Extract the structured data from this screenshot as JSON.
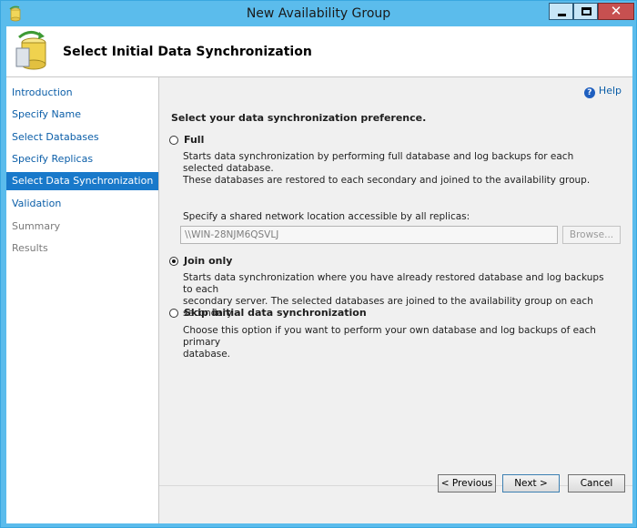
{
  "window": {
    "title": "New Availability Group"
  },
  "header": {
    "title": "Select Initial Data Synchronization"
  },
  "nav": {
    "items": [
      {
        "label": "Introduction",
        "state": "link"
      },
      {
        "label": "Specify Name",
        "state": "link"
      },
      {
        "label": "Select Databases",
        "state": "link"
      },
      {
        "label": "Specify Replicas",
        "state": "link"
      },
      {
        "label": "Select Data Synchronization",
        "state": "selected"
      },
      {
        "label": "Validation",
        "state": "link"
      },
      {
        "label": "Summary",
        "state": "disabled"
      },
      {
        "label": "Results",
        "state": "disabled"
      }
    ]
  },
  "main": {
    "help_label": "Help",
    "preference_label": "Select your data synchronization preference.",
    "options": {
      "full": {
        "label": "Full",
        "selected": false,
        "description_line1": "Starts data synchronization by performing full database and log backups for each selected database.",
        "description_line2": "These databases are restored to each secondary and joined to the availability group."
      },
      "join_only": {
        "label": "Join only",
        "selected": true,
        "description_line1": "Starts data synchronization where you have already restored database and log backups to each",
        "description_line2": "secondary server. The selected databases are joined to the availability group on each secondary."
      },
      "skip": {
        "label": "Skip initial data synchronization",
        "selected": false,
        "description_line1": "Choose this option if you want to perform your own database and log backups of each primary",
        "description_line2": "database."
      }
    },
    "shared_location_label": "Specify a shared network location accessible by all replicas:",
    "shared_location_value": "\\\\WIN-28NJM6QSVLJ",
    "browse_label": "Browse..."
  },
  "buttons": {
    "previous": "< Previous",
    "next": "Next >",
    "cancel": "Cancel"
  },
  "colors": {
    "title_bar": "#5bbcec",
    "nav_selected": "#1979ca",
    "link": "#0b5ea8",
    "close_button": "#c75050"
  },
  "icons": {
    "app": "availability-group-app-icon",
    "header": "database-sync-icon",
    "help": "help-icon"
  }
}
